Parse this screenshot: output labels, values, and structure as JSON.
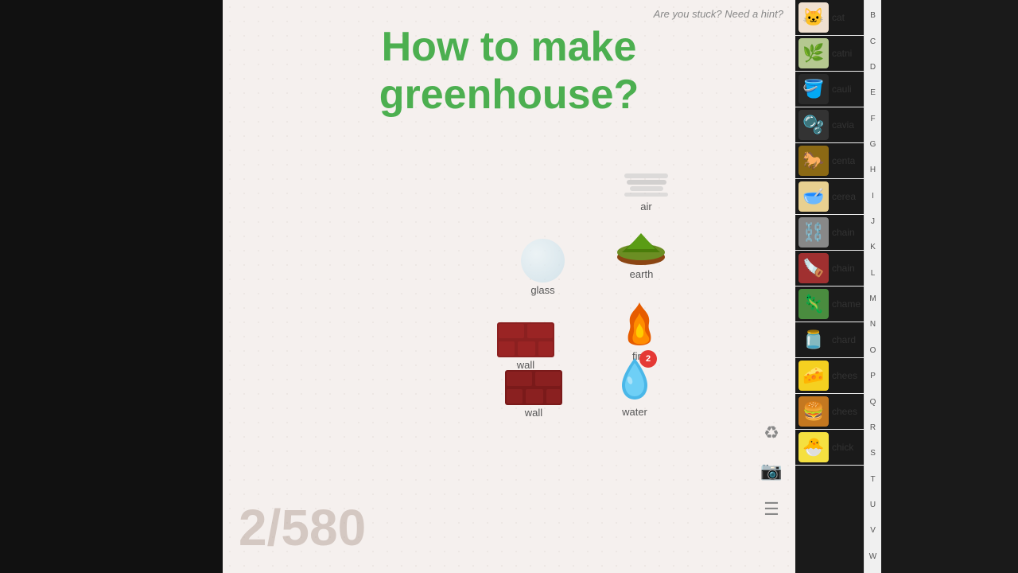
{
  "layout": {
    "bg_left": "#111111",
    "bg_main": "#f5f0ee",
    "bg_sidebar": "#f9f9f9"
  },
  "hint": {
    "text": "Are you stuck? Need a hint?"
  },
  "title": {
    "line1": "How to make",
    "line2": "greenhouse?"
  },
  "counter": {
    "value": "2/580"
  },
  "elements": [
    {
      "id": "air",
      "label": "air",
      "emoji": "☁️",
      "type": "air"
    },
    {
      "id": "glass",
      "label": "glass",
      "type": "glass"
    },
    {
      "id": "earth",
      "label": "earth",
      "type": "earth"
    },
    {
      "id": "fire",
      "label": "fire",
      "emoji": "🔥",
      "type": "fire"
    },
    {
      "id": "wall1",
      "label": "wall",
      "type": "brick"
    },
    {
      "id": "wall2",
      "label": "wall",
      "type": "brick"
    },
    {
      "id": "water",
      "label": "water",
      "type": "water"
    }
  ],
  "toolbar": {
    "recycle_icon": "♻",
    "camera_icon": "📷",
    "menu_icon": "☰",
    "badge_count": "2"
  },
  "alpha_nav": [
    "B",
    "C",
    "D",
    "E",
    "F",
    "G",
    "H",
    "I",
    "J",
    "K",
    "L",
    "M",
    "N",
    "O",
    "P",
    "Q",
    "R",
    "S",
    "T",
    "U",
    "V",
    "W"
  ],
  "sidebar_items": [
    {
      "name": "cat",
      "emoji": "🐱"
    },
    {
      "name": "catnip",
      "emoji": "🌿"
    },
    {
      "name": "cauliflower",
      "emoji": "🪣"
    },
    {
      "name": "caviar",
      "emoji": "🫧"
    },
    {
      "name": "centaur",
      "emoji": "🐎"
    },
    {
      "name": "cereal",
      "emoji": "🥣"
    },
    {
      "name": "chain",
      "emoji": "⛓️"
    },
    {
      "name": "chainsaw",
      "emoji": "🪚"
    },
    {
      "name": "chameleon",
      "emoji": "🦎"
    },
    {
      "name": "chard",
      "emoji": "🫙"
    },
    {
      "name": "cheese",
      "emoji": "🧀"
    },
    {
      "name": "cheeseburger",
      "emoji": "🍔"
    },
    {
      "name": "chick",
      "emoji": "🐣"
    }
  ]
}
